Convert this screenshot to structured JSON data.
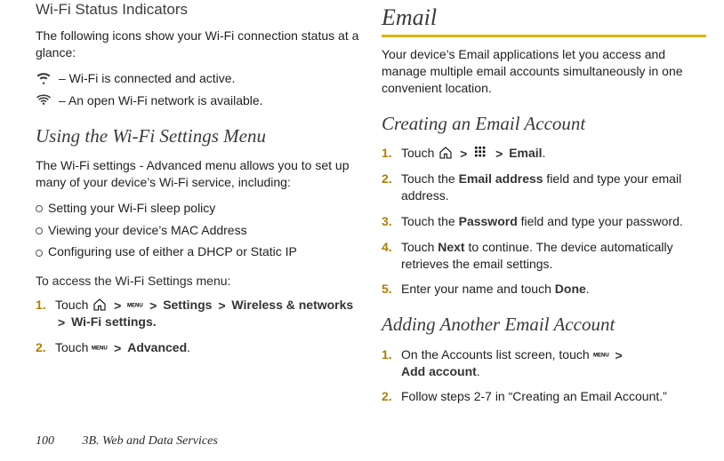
{
  "left": {
    "h2_status": "Wi-Fi Status Indicators",
    "status_intro": "The following icons show your Wi-Fi connection status at a glance:",
    "icon_active": " – Wi-Fi is connected and active.",
    "icon_open": " – An open Wi-Fi network is available.",
    "h3_menu": "Using the Wi-Fi Settings Menu",
    "menu_intro": "The Wi-Fi settings - Advanced menu allows you to set up many of your device’s Wi-Fi service, including:",
    "bullets": [
      "Setting your Wi-Fi sleep policy",
      "Viewing your device’s MAC Address",
      "Configuring use of either a DHCP or Static IP"
    ],
    "runin": "To access the Wi-Fi Settings menu:",
    "step1_pre": "Touch ",
    "step1_settings": "Settings",
    "step1_wireless": "Wireless & networks",
    "step1_wifi": "Wi-Fi settings.",
    "step2_pre": "Touch ",
    "step2_adv": "Advanced",
    "step2_post": "."
  },
  "right": {
    "h1": "Email",
    "intro": "Your device’s Email applications let you access and manage multiple email accounts simultaneously in one convenient location.",
    "h3_create": "Creating an Email Account",
    "c1_pre": "Touch ",
    "c1_email": "Email",
    "c1_post": ".",
    "c2_a": "Touch the ",
    "c2_b": "Email address",
    "c2_c": " field and type your email address.",
    "c3_a": "Touch the ",
    "c3_b": "Password",
    "c3_c": " field and type your password.",
    "c4_a": "Touch ",
    "c4_b": "Next",
    "c4_c": " to continue. The device automatically retrieves the email settings.",
    "c5_a": "Enter your name and touch ",
    "c5_b": "Done",
    "c5_c": ".",
    "h3_add": "Adding Another Email Account",
    "a1_a": "On the Accounts list screen, touch ",
    "a1_b": "Add account",
    "a1_c": ".",
    "a2": "Follow steps 2-7 in “Creating an Email Account.”"
  },
  "footer": {
    "page": "100",
    "chapter": "3B. Web and Data Services"
  }
}
